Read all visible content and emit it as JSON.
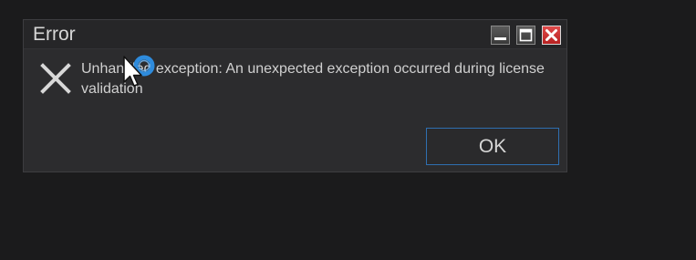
{
  "dialog": {
    "title": "Error",
    "message": "Unhandled exception: An unexpected exception occurred during license validation",
    "ok_label": "OK",
    "title_buttons": [
      "minimize-icon",
      "maximize-icon",
      "close-icon"
    ],
    "icon": "error-x-icon"
  },
  "colors": {
    "background": "#1b1b1c",
    "dialog_bg": "#2c2c2e",
    "text": "#d0d0d0",
    "ok_border": "#2f6fb0",
    "close_button": "#c62828",
    "cursor_ring": "#2e8bdc"
  },
  "cursor": "busy-pointer-icon"
}
